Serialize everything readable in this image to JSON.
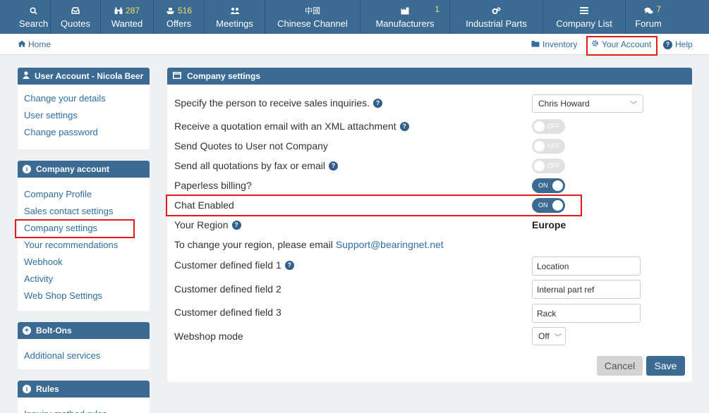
{
  "nav": {
    "search": "Search",
    "quotes": "Quotes",
    "wanted": "Wanted",
    "wanted_count": "287",
    "offers": "Offers",
    "offers_count": "516",
    "meetings": "Meetings",
    "chinese_glyph": "中國",
    "chinese": "Chinese Channel",
    "manufacturers": "Manufacturers",
    "manufacturers_count": "1",
    "industrial": "Industrial Parts",
    "company_list": "Company List",
    "forum": "Forum",
    "forum_count": "7"
  },
  "breadcrumb": {
    "home": "Home"
  },
  "toplinks": {
    "inventory": "Inventory",
    "your_account": "Your Account",
    "help": "Help"
  },
  "sidebar": {
    "user_account": {
      "title": "User Account - Nicola Beer",
      "links": [
        "Change your details",
        "User settings",
        "Change password"
      ]
    },
    "company_account": {
      "title": "Company account",
      "links": [
        "Company Profile",
        "Sales contact settings",
        "Company settings",
        "Your recommendations",
        "Webhook",
        "Activity",
        "Web Shop Settings"
      ]
    },
    "bolt_ons": {
      "title": "Bolt-Ons",
      "links": [
        "Additional services"
      ]
    },
    "rules": {
      "title": "Rules",
      "links": [
        "Inquiry method rules"
      ]
    }
  },
  "settings": {
    "title": "Company settings",
    "sales_person_label": "Specify the person to receive sales inquiries.",
    "sales_person_value": "Chris Howard",
    "xml_label": "Receive a quotation email with an XML attachment",
    "quotes_user_label": "Send Quotes to User not Company",
    "fax_email_label": "Send all quotations by fax or email",
    "paperless_label": "Paperless billing?",
    "chat_label": "Chat Enabled",
    "toggle_off": "OFF",
    "toggle_on": "ON",
    "region_label": "Your Region",
    "region_value": "Europe",
    "change_region_text": "To change your region, please email",
    "support_email": "Support@bearingnet.net",
    "cf1_label": "Customer defined field 1",
    "cf1_value": "Location",
    "cf2_label": "Customer defined field 2",
    "cf2_value": "Internal part ref",
    "cf3_label": "Customer defined field 3",
    "cf3_value": "Rack",
    "webshop_label": "Webshop mode",
    "webshop_value": "Off",
    "cancel": "Cancel",
    "save": "Save"
  },
  "colors": {
    "nav_bg": "#3b6a93",
    "highlight_red": "#e01c1c",
    "link": "#2f6ea0",
    "toggle_on": "#3b6a93"
  }
}
